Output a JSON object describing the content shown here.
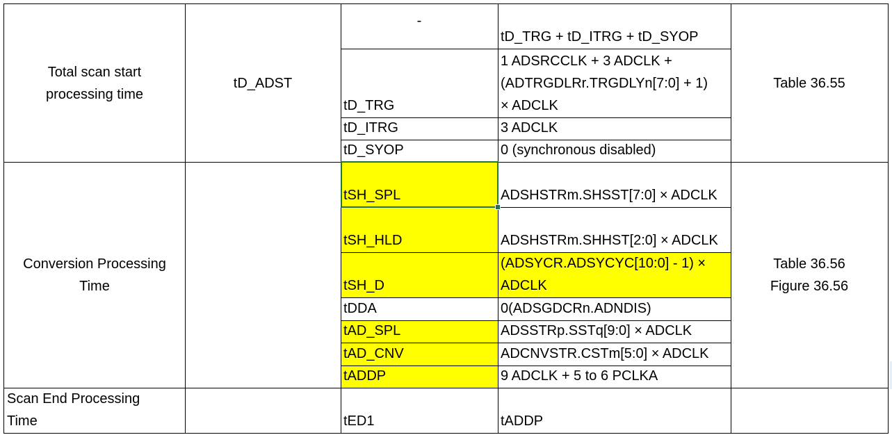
{
  "rows": {
    "total_scan": {
      "label_lines": [
        "Total scan start",
        "processing time"
      ],
      "symbol": "tD_ADST",
      "dash": "-",
      "formula": "tD_TRG + tD_ITRG + tD_SYOP",
      "reference": "Table 36.55",
      "sub": [
        {
          "name": "tD_TRG",
          "value_lines": [
            "1 ADSRCCLK + 3 ADCLK +",
            "(ADTRGDLRr.TRGDLYn[7:0] + 1)",
            "× ADCLK"
          ]
        },
        {
          "name": "tD_ITRG",
          "value": "3 ADCLK"
        },
        {
          "name": "tD_SYOP",
          "value": "0 (synchronous  disabled)"
        }
      ]
    },
    "conversion": {
      "label_lines": [
        "Conversion Processing",
        "Time"
      ],
      "reference_lines": [
        "Table 36.56",
        "Figure 36.56"
      ],
      "sub": [
        {
          "name": "tSH_SPL",
          "value": "ADSHSTRm.SHSST[7:0] × ADCLK"
        },
        {
          "name": "tSH_HLD",
          "value": "ADSHSTRm.SHHST[2:0] × ADCLK"
        },
        {
          "name": "tSH_D",
          "value_lines": [
            "(ADSYCR.ADSYCYC[10:0] - 1) ×",
            "ADCLK"
          ]
        },
        {
          "name": "tDDA",
          "value": "0(ADSGDCRn.ADNDIS)"
        },
        {
          "name": "tAD_SPL",
          "value": "ADSSTRp.SSTq[9:0] × ADCLK"
        },
        {
          "name": "tAD_CNV",
          "value": "ADCNVSTR.CSTm[5:0] × ADCLK"
        },
        {
          "name": "tADDP",
          "value": "9 ADCLK + 5 to 6 PCLKA"
        }
      ]
    },
    "scan_end": {
      "label_lines": [
        "Scan End Processing",
        "Time"
      ],
      "name": "tED1",
      "value": "tADDP"
    }
  },
  "colors": {
    "highlight": "#ffff00",
    "selection": "#217346",
    "border": "#000000"
  }
}
